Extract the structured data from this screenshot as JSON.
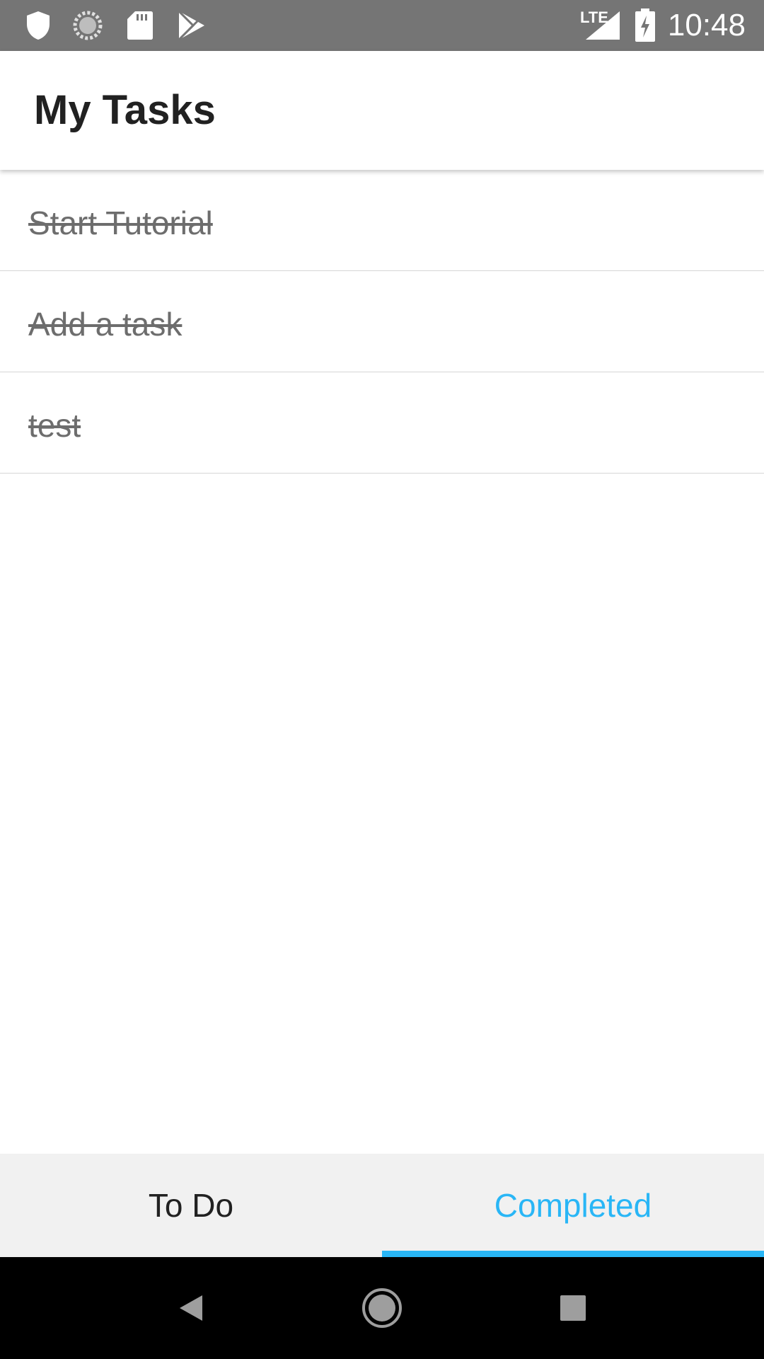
{
  "status_bar": {
    "time": "10:48",
    "network_label": "LTE",
    "left_icons": [
      "shield-icon",
      "sync-icon",
      "sd-card-icon",
      "play-store-icon"
    ],
    "right_icons": [
      "signal-icon",
      "battery-charging-icon"
    ]
  },
  "app_bar": {
    "title": "My Tasks"
  },
  "tasks": [
    {
      "label": "Start Tutorial",
      "completed": true
    },
    {
      "label": "Add a task",
      "completed": true
    },
    {
      "label": "test",
      "completed": true
    }
  ],
  "tabs": {
    "todo": "To Do",
    "completed": "Completed",
    "selected": "completed"
  },
  "colors": {
    "accent": "#29b6f6",
    "status_bar": "#757575",
    "tab_bar_bg": "#f1f1f1",
    "completed_text": "#6d6d6d"
  },
  "nav_bar": {
    "buttons": [
      "back-icon",
      "home-icon",
      "recents-icon"
    ]
  }
}
